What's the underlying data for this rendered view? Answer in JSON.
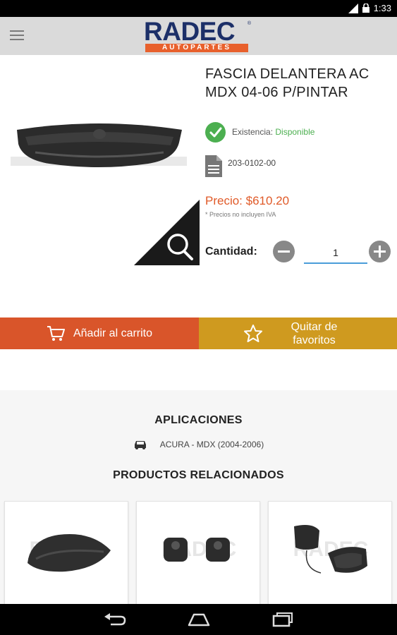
{
  "status_bar": {
    "time": "1:33"
  },
  "app_bar": {
    "menu_icon": "hamburger-menu-icon",
    "logo": {
      "name": "RADEC",
      "tagline": "AUTOPARTES"
    }
  },
  "product": {
    "title": "FASCIA DELANTERA AC MDX 04-06 P/PINTAR",
    "stock": {
      "label": "Existencia:",
      "value": "Disponible",
      "icon": "check-circle-icon",
      "color": "#4caf50"
    },
    "sku": {
      "icon": "document-icon",
      "value": "203-0102-00"
    },
    "price": {
      "label": "Precio: $610.20",
      "note": "* Precios no incluyen IVA",
      "color": "#e05a28"
    },
    "quantity": {
      "label": "Cantidad:",
      "value": "1"
    },
    "zoom_icon": "magnifier-icon"
  },
  "actions": {
    "add_to_cart": {
      "label": "Añadir al carrito",
      "icon": "cart-icon",
      "color": "#d9552a"
    },
    "remove_favorite": {
      "label": "Quitar de favoritos",
      "icon": "star-outline-icon",
      "color": "#cf9a1f"
    }
  },
  "applications": {
    "title": "APLICACIONES",
    "items": [
      {
        "icon": "car-icon",
        "text": "ACURA - MDX (2004-2006)"
      }
    ]
  },
  "related": {
    "title": "PRODUCTOS RELACIONADOS",
    "items": [
      {
        "name": "hood-product-card"
      },
      {
        "name": "bushing-product-card"
      },
      {
        "name": "mirror-product-card"
      }
    ]
  },
  "nav_bar": {
    "buttons": [
      "back-icon",
      "home-icon",
      "recent-apps-icon"
    ]
  }
}
